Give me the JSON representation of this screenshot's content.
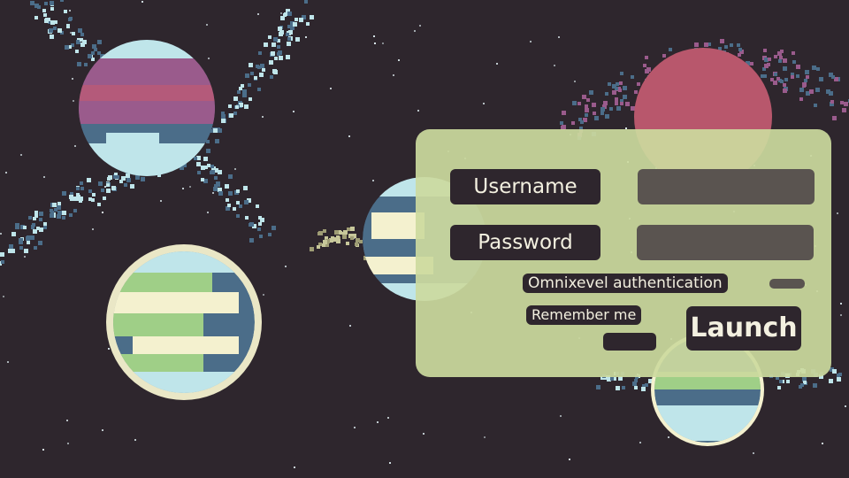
{
  "login": {
    "username_label": "Username",
    "password_label": "Password",
    "omnixevel_label": "Omnixevel authentication",
    "remember_label": "Remember me",
    "launch_label": "Launch",
    "username_value": "",
    "password_value": ""
  },
  "colors": {
    "background": "#2e262d",
    "panel": "#ccda9e",
    "label_bg": "#2e262d",
    "input_bg": "#5a5450",
    "text": "#f3f0e0"
  },
  "planets": [
    {
      "name": "purple-gas-planet",
      "colors": [
        "#4b6d89",
        "#9a5b8c",
        "#bfe5ea"
      ]
    },
    {
      "name": "earth-like-planet",
      "colors": [
        "#4b6d89",
        "#9fcf87",
        "#f4f1cf"
      ]
    },
    {
      "name": "ice-ocean-planet",
      "colors": [
        "#4b6d89",
        "#f4f1cf",
        "#bfe5ea"
      ]
    },
    {
      "name": "red-planet",
      "colors": [
        "#b8576c"
      ]
    },
    {
      "name": "small-ocean-planet",
      "colors": [
        "#4b6d89",
        "#9fcf87"
      ]
    }
  ]
}
